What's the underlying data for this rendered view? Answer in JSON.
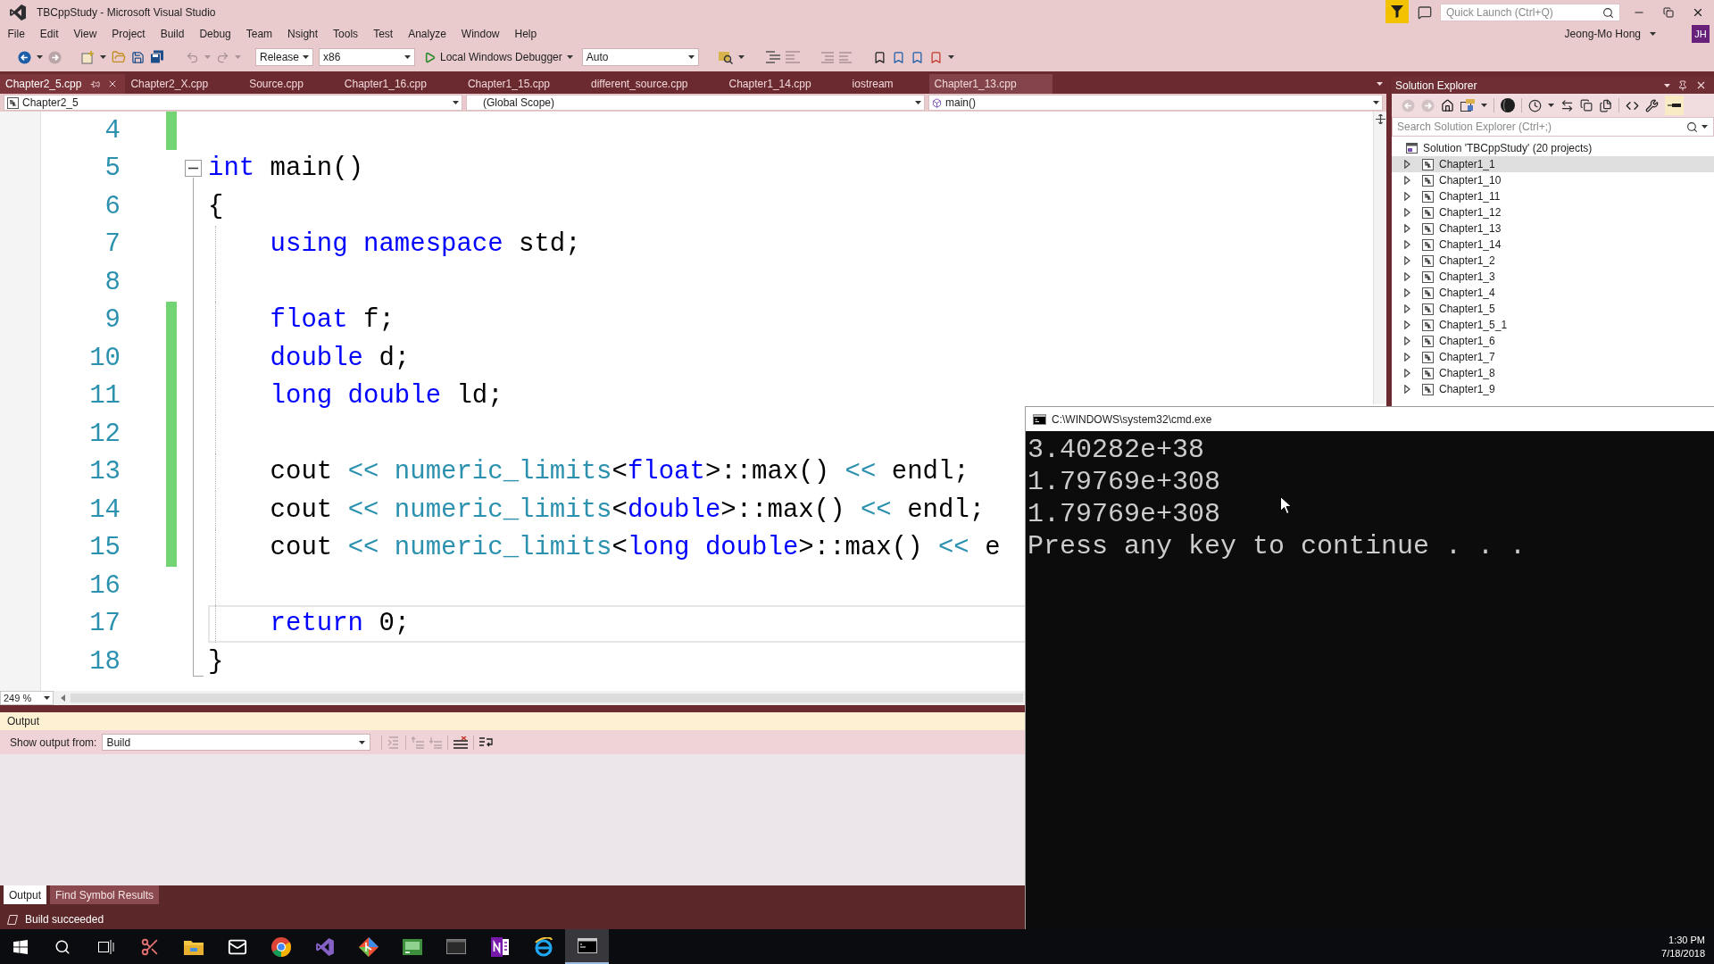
{
  "window": {
    "title": "TBCppStudy - Microsoft Visual Studio"
  },
  "quick_launch": {
    "placeholder": "Quick Launch (Ctrl+Q)"
  },
  "menu": [
    "File",
    "Edit",
    "View",
    "Project",
    "Build",
    "Debug",
    "Team",
    "Nsight",
    "Tools",
    "Test",
    "Analyze",
    "Window",
    "Help"
  ],
  "account": {
    "name": "Jeong-Mo Hong",
    "initials": "JH"
  },
  "toolbar": [
    {
      "kind": "dropdown",
      "value": "Release"
    },
    {
      "kind": "dropdown",
      "value": "x86"
    },
    {
      "kind": "run",
      "label": "Local Windows Debugger"
    },
    {
      "kind": "dropdown",
      "value": "Auto"
    }
  ],
  "tabs": [
    {
      "label": "Chapter2_5.cpp",
      "selected": true,
      "hovered": false
    },
    {
      "label": "Chapter2_X.cpp",
      "selected": false,
      "hovered": false
    },
    {
      "label": "Source.cpp",
      "selected": false,
      "hovered": false
    },
    {
      "label": "Chapter1_16.cpp",
      "selected": false,
      "hovered": false
    },
    {
      "label": "Chapter1_15.cpp",
      "selected": false,
      "hovered": false
    },
    {
      "label": "different_source.cpp",
      "selected": false,
      "hovered": false
    },
    {
      "label": "Chapter1_14.cpp",
      "selected": false,
      "hovered": false
    },
    {
      "label": "iostream",
      "selected": false,
      "hovered": false
    },
    {
      "label": "Chapter1_13.cpp",
      "selected": false,
      "hovered": true
    }
  ],
  "navigation_bar": {
    "project": "Chapter2_5",
    "scope": "(Global Scope)",
    "member": "main()"
  },
  "editor": {
    "lines": [
      {
        "number": "4",
        "changed": true,
        "current": false
      },
      {
        "number": "5",
        "changed": false,
        "current": false,
        "fold": {
          "expanded": true
        },
        "tokens": [
          {
            "kind": "keyword",
            "text": "int"
          },
          {
            "kind": "plain",
            "text": " main()"
          }
        ]
      },
      {
        "number": "6",
        "changed": false,
        "current": false,
        "tokens": [
          {
            "kind": "plain",
            "text": "{"
          }
        ]
      },
      {
        "number": "7",
        "changed": false,
        "current": false,
        "tokens": [
          {
            "kind": "keyword",
            "text": "    using namespace"
          },
          {
            "kind": "plain",
            "text": " std;"
          }
        ]
      },
      {
        "number": "8",
        "changed": false,
        "current": false
      },
      {
        "number": "9",
        "changed": true,
        "current": false,
        "tokens": [
          {
            "kind": "keyword",
            "text": "    float"
          },
          {
            "kind": "plain",
            "text": " f;"
          }
        ]
      },
      {
        "number": "10",
        "changed": true,
        "current": false,
        "tokens": [
          {
            "kind": "keyword",
            "text": "    double"
          },
          {
            "kind": "plain",
            "text": " d;"
          }
        ]
      },
      {
        "number": "11",
        "changed": true,
        "current": false,
        "tokens": [
          {
            "kind": "keyword",
            "text": "    long double"
          },
          {
            "kind": "plain",
            "text": " ld;"
          }
        ]
      },
      {
        "number": "12",
        "changed": true,
        "current": false
      },
      {
        "number": "13",
        "changed": true,
        "current": false,
        "tokens": [
          {
            "kind": "plain",
            "text": "    cout "
          },
          {
            "kind": "operator",
            "text": "<< "
          },
          {
            "kind": "type",
            "text": "numeric_limits"
          },
          {
            "kind": "plain",
            "text": "<"
          },
          {
            "kind": "keyword",
            "text": "float"
          },
          {
            "kind": "plain",
            "text": ">::max() "
          },
          {
            "kind": "operator",
            "text": "<<"
          },
          {
            "kind": "plain",
            "text": " endl;"
          }
        ]
      },
      {
        "number": "14",
        "changed": true,
        "current": false,
        "tokens": [
          {
            "kind": "plain",
            "text": "    cout "
          },
          {
            "kind": "operator",
            "text": "<< "
          },
          {
            "kind": "type",
            "text": "numeric_limits"
          },
          {
            "kind": "plain",
            "text": "<"
          },
          {
            "kind": "keyword",
            "text": "double"
          },
          {
            "kind": "plain",
            "text": ">::max() "
          },
          {
            "kind": "operator",
            "text": "<<"
          },
          {
            "kind": "plain",
            "text": " endl;"
          }
        ]
      },
      {
        "number": "15",
        "changed": true,
        "current": false,
        "tokens": [
          {
            "kind": "plain",
            "text": "    cout "
          },
          {
            "kind": "operator",
            "text": "<< "
          },
          {
            "kind": "type",
            "text": "numeric_limits"
          },
          {
            "kind": "plain",
            "text": "<"
          },
          {
            "kind": "keyword",
            "text": "long double"
          },
          {
            "kind": "plain",
            "text": ">::max() "
          },
          {
            "kind": "operator",
            "text": "<<"
          },
          {
            "kind": "plain",
            "text": " e"
          }
        ]
      },
      {
        "number": "16",
        "changed": false,
        "current": false
      },
      {
        "number": "17",
        "changed": false,
        "current": true,
        "tokens": [
          {
            "kind": "keyword",
            "text": "    return"
          },
          {
            "kind": "plain",
            "text": " 0;"
          }
        ]
      },
      {
        "number": "18",
        "changed": false,
        "current": false,
        "tokens": [
          {
            "kind": "plain",
            "text": "}"
          }
        ]
      }
    ],
    "zoom": "249 %"
  },
  "output": {
    "title": "Output",
    "source_label": "Show output from:",
    "source": "Build",
    "tabs": [
      {
        "label": "Output",
        "selected": true
      },
      {
        "label": "Find Symbol Results",
        "selected": false
      }
    ]
  },
  "status_bar": {
    "message": "Build succeeded"
  },
  "solution_explorer": {
    "title": "Solution Explorer",
    "search": {
      "placeholder": "Search Solution Explorer (Ctrl+;)"
    },
    "solution": "Solution 'TBCppStudy' (20 projects)",
    "items": [
      {
        "label": "Chapter1_1",
        "selected": true,
        "expanded": false
      },
      {
        "label": "Chapter1_10",
        "selected": false,
        "expanded": false
      },
      {
        "label": "Chapter1_11",
        "selected": false,
        "expanded": false
      },
      {
        "label": "Chapter1_12",
        "selected": false,
        "expanded": false
      },
      {
        "label": "Chapter1_13",
        "selected": false,
        "expanded": false
      },
      {
        "label": "Chapter1_14",
        "selected": false,
        "expanded": false
      },
      {
        "label": "Chapter1_2",
        "selected": false,
        "expanded": false
      },
      {
        "label": "Chapter1_3",
        "selected": false,
        "expanded": false
      },
      {
        "label": "Chapter1_4",
        "selected": false,
        "expanded": false
      },
      {
        "label": "Chapter1_5",
        "selected": false,
        "expanded": false
      },
      {
        "label": "Chapter1_5_1",
        "selected": false,
        "expanded": false
      },
      {
        "label": "Chapter1_6",
        "selected": false,
        "expanded": false
      },
      {
        "label": "Chapter1_7",
        "selected": false,
        "expanded": false
      },
      {
        "label": "Chapter1_8",
        "selected": false,
        "expanded": false
      },
      {
        "label": "Chapter1_9",
        "selected": false,
        "expanded": false
      }
    ]
  },
  "console": {
    "title": "C:\\WINDOWS\\system32\\cmd.exe",
    "lines": [
      "3.40282e+38",
      "1.79769e+308",
      "1.79769e+308",
      "Press any key to continue . . ."
    ]
  },
  "taskbar": {
    "items": [
      {
        "kind": "start",
        "selected": false
      },
      {
        "kind": "search",
        "selected": false
      },
      {
        "kind": "taskview",
        "selected": false
      },
      {
        "kind": "scissors",
        "selected": false
      },
      {
        "kind": "folder",
        "selected": false
      },
      {
        "kind": "mail",
        "selected": false
      },
      {
        "kind": "globe",
        "selected": false
      },
      {
        "kind": "studio",
        "selected": false
      },
      {
        "kind": "diamond",
        "selected": false
      },
      {
        "kind": "board",
        "selected": false
      },
      {
        "kind": "screen",
        "selected": false
      },
      {
        "kind": "notebook",
        "selected": false
      },
      {
        "kind": "web",
        "selected": false
      },
      {
        "kind": "terminal",
        "selected": true
      }
    ],
    "time": "1:30 PM",
    "date": "7/18/2018"
  }
}
